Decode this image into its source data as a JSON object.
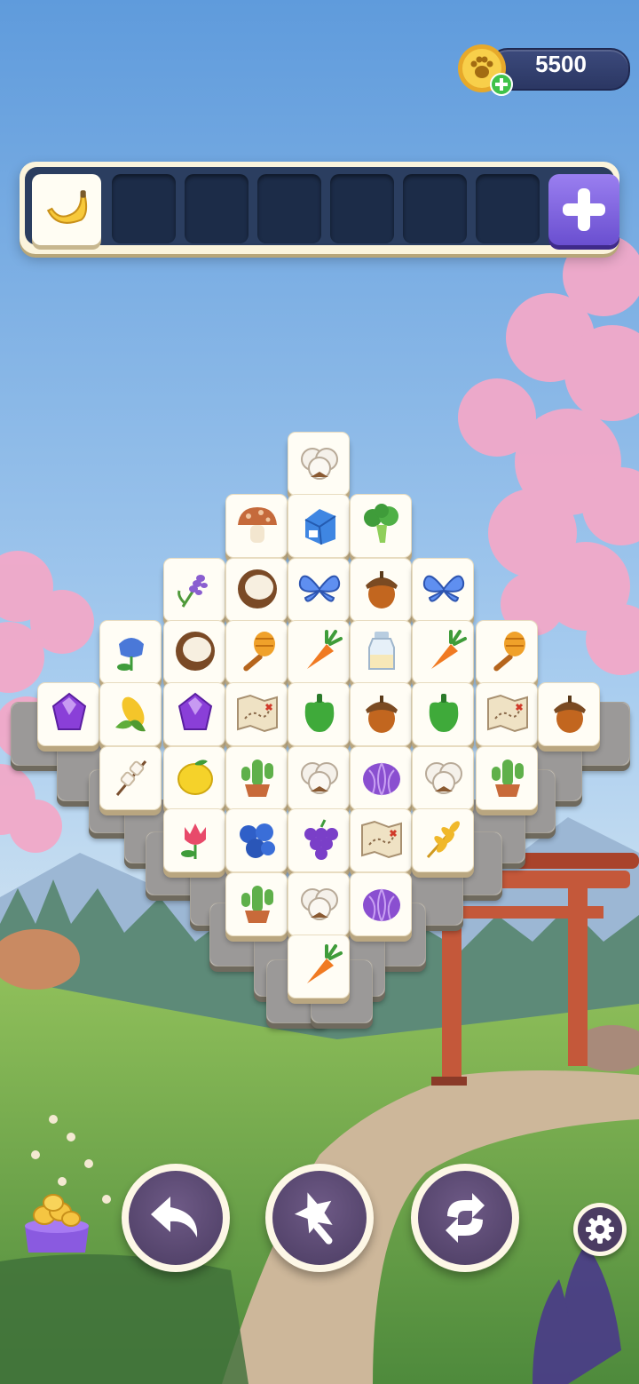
{
  "hud": {
    "coins": "5500",
    "coin_icon": "paw-coin-icon",
    "add_coins_icon": "plus-icon"
  },
  "tray": {
    "slots_total": 7,
    "filled": [
      {
        "icon": "banana-icon"
      }
    ],
    "add_slot_icon": "plus-icon"
  },
  "board": {
    "tiles": [
      "cotton",
      "mushroom",
      "milk-carton",
      "broccoli",
      "lavender",
      "coconut",
      "butterfly",
      "acorn",
      "butterfly",
      "bluebell",
      "coconut",
      "honey-dipper",
      "carrot",
      "milk-bottle",
      "carrot",
      "honey-dipper",
      "crystal",
      "corn",
      "crystal",
      "treasure-map",
      "bell-pepper",
      "acorn",
      "bell-pepper",
      "treasure-map",
      "acorn",
      "marshmallow",
      "lemon",
      "cactus",
      "cotton",
      "cabbage",
      "cotton",
      "cactus",
      "tulip",
      "blueberries",
      "grapes",
      "treasure-map",
      "wheat",
      "cactus",
      "cotton",
      "cabbage",
      "carrot"
    ],
    "covered_tiles": 18
  },
  "controls": {
    "undo_icon": "undo-arrow-icon",
    "magic_icon": "magic-wand-icon",
    "shuffle_icon": "shuffle-icon",
    "settings_icon": "gear-icon",
    "shop_icon": "coin-stack-icon"
  },
  "colors": {
    "tray_frame": "#fbf4dc",
    "tray_slot": "#1c2c48",
    "button_purple": "#4b3c62",
    "add_button": "#7a5ee0",
    "coin_gold": "#f5c542"
  }
}
